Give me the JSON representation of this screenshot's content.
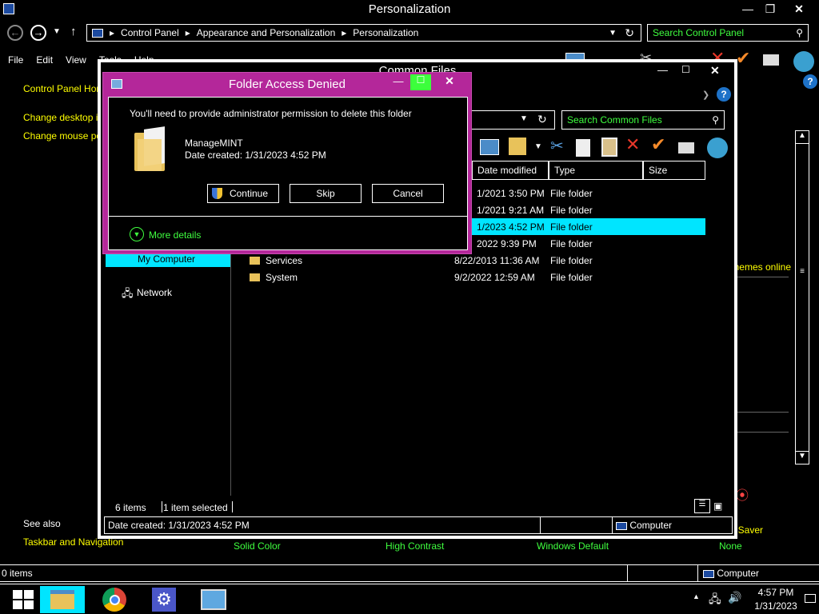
{
  "main_window": {
    "title": "Personalization",
    "breadcrumb": [
      "Control Panel",
      "Appearance and Personalization",
      "Personalization"
    ],
    "search_placeholder": "Search Control Panel",
    "menu": [
      "File",
      "Edit",
      "View",
      "Tools",
      "Help"
    ],
    "sidebar_links": [
      "Control Panel Home",
      "Change desktop icons",
      "Change mouse pointers"
    ],
    "see_also_label": "See also",
    "see_also_links": [
      "Taskbar and Navigation"
    ],
    "themes_link": "Get more themes online",
    "screen_saver_label": "Screen Saver",
    "bottom_items": [
      "Solid Color",
      "High Contrast",
      "Windows Default",
      "None"
    ],
    "status_items": "0 items",
    "status_computer": "Computer"
  },
  "explorer_window": {
    "title": "Common Files",
    "search_placeholder": "Search Common Files",
    "columns": [
      "Date modified",
      "Type",
      "Size"
    ],
    "nav_items": [
      "My Computer",
      "Network"
    ],
    "rows": [
      {
        "name": "",
        "date": "1/2021 3:50 PM",
        "type": "File folder",
        "selected": false
      },
      {
        "name": "",
        "date": "1/2021 9:21 AM",
        "type": "File folder",
        "selected": false
      },
      {
        "name": "",
        "date": "1/2023 4:52 PM",
        "type": "File folder",
        "selected": true
      },
      {
        "name": "",
        "date": "2022 9:39 PM",
        "type": "File folder",
        "selected": false
      },
      {
        "name": "Services",
        "date": "8/22/2013 11:36 AM",
        "type": "File folder",
        "selected": false
      },
      {
        "name": "System",
        "date": "9/2/2022 12:59 AM",
        "type": "File folder",
        "selected": false
      }
    ],
    "status_count": "6 items",
    "status_selected": "1 item selected",
    "details_text": "Date created: 1/31/2023 4:52 PM",
    "details_location": "Computer"
  },
  "dialog": {
    "title": "Folder Access Denied",
    "message": "You'll need to provide administrator permission to delete this folder",
    "folder_name": "ManageMINT",
    "folder_date": "Date created: 1/31/2023 4:52 PM",
    "continue_label": "Continue",
    "skip_label": "Skip",
    "cancel_label": "Cancel",
    "more_details_label": "More details"
  },
  "taskbar": {
    "time": "4:57 PM",
    "date": "1/31/2023"
  },
  "colors": {
    "dialog_accent": "#b4279a",
    "selection": "#00e5ff",
    "link_yellow": "#ffff00",
    "link_green": "#3fff3f"
  }
}
